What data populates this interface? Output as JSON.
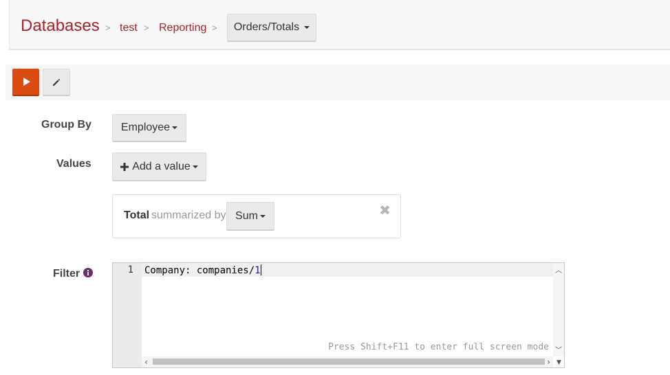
{
  "breadcrumb": {
    "root": "Databases",
    "separator": ">",
    "items": [
      "test",
      "Reporting"
    ],
    "current": "Orders/Totals"
  },
  "toolbar": {
    "run_icon": "play-icon",
    "edit_icon": "pencil-icon"
  },
  "form": {
    "group_by_label": "Group By",
    "group_by_value": "Employee",
    "values_label": "Values",
    "add_value_label": "Add a value",
    "value_item": {
      "field": "Total",
      "summarized_by_text": "summarized by",
      "aggregation": "Sum",
      "remove_icon": "close-icon"
    },
    "filter_label": "Filter",
    "filter_info_icon": "info-icon"
  },
  "editor": {
    "line_number": "1",
    "code_prefix": "Company: companies/",
    "code_number": "1",
    "hint": "Press Shift+F11 to enter full screen mode"
  },
  "colors": {
    "brand": "#a4242d",
    "run_button": "#db4c13"
  }
}
